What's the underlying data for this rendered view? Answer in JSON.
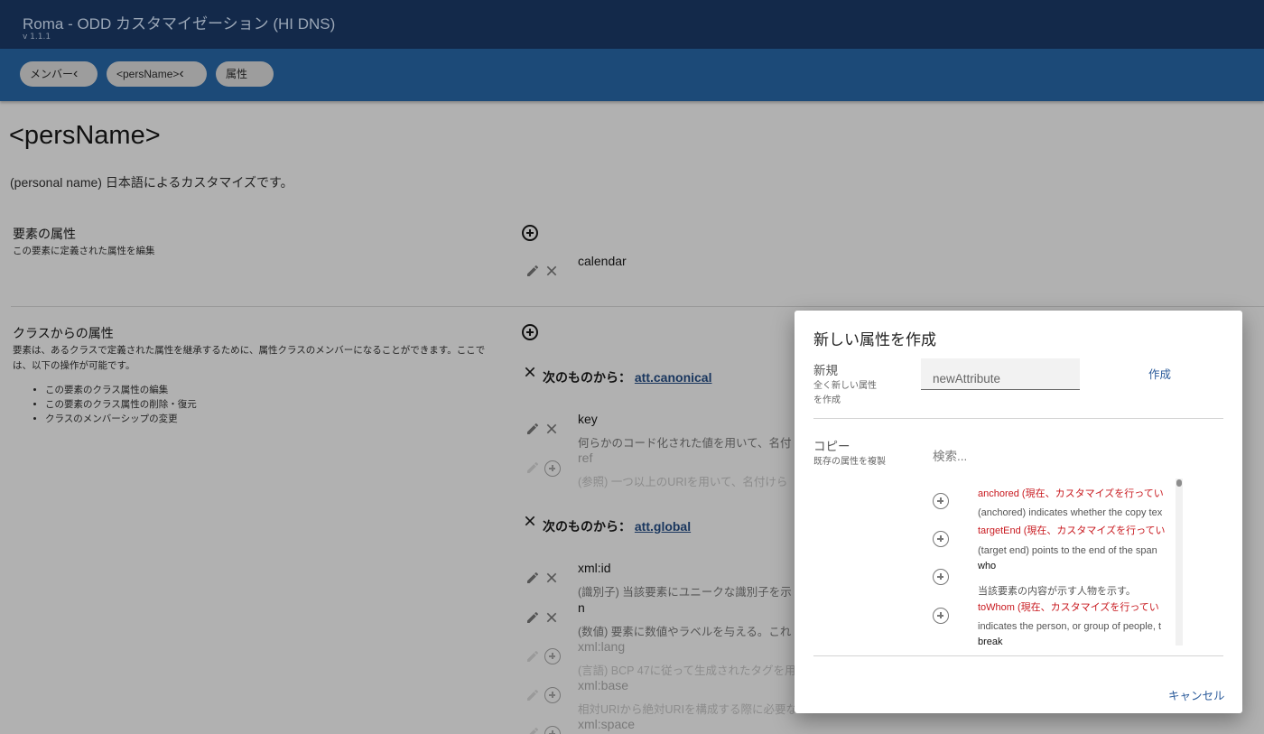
{
  "app": {
    "title": "Roma - ODD カスタマイゼーション (HI DNS)",
    "version": "v 1.1.1"
  },
  "breadcrumbs": [
    {
      "label": "メンバー",
      "chevron": "‹"
    },
    {
      "label": "<persName>",
      "chevron": "‹"
    },
    {
      "label": "属性"
    }
  ],
  "element": {
    "title": "<persName>",
    "description": "(personal name) 日本語によるカスタマイズです。"
  },
  "element_attributes": {
    "title": "要素の属性",
    "subtitle": "この要素に定義された属性を編集",
    "items": [
      {
        "name": "calendar"
      }
    ]
  },
  "class_attributes": {
    "title": "クラスからの属性",
    "subtitle": "要素は、あるクラスで定義された属性を継承するために、属性クラスのメンバーになることができます。ここでは、以下の操作が可能です。",
    "bullets": [
      "この要素のクラス属性の編集",
      "この要素のクラス属性の削除・復元",
      "クラスのメンバーシップの変更"
    ],
    "from_prefix": "次のものから：",
    "groups": [
      {
        "class": "att.canonical",
        "items": [
          {
            "name": "key",
            "desc": "何らかのコード化された値を用いて、名付"
          },
          {
            "name": "ref",
            "desc": "(参照) 一つ以上のURIを用いて、名付けら"
          }
        ]
      },
      {
        "class": "att.global",
        "items": [
          {
            "name": "xml:id",
            "desc": "(識別子) 当該要素にユニークな識別子を示"
          },
          {
            "name": "n",
            "desc": "(数値) 要素に数値やラベルを与える。これ"
          },
          {
            "name": "xml:lang",
            "desc": "(言語) BCP 47に従って生成されたタグを用"
          },
          {
            "name": "xml:base",
            "desc": "相対URIから絶対URIを構成する際に必要な"
          },
          {
            "name": "xml:space",
            "desc": ""
          }
        ]
      }
    ]
  },
  "dialog": {
    "title": "新しい属性を作成",
    "new_label": "新規",
    "new_sub": "全く新しい属性を作成",
    "input_placeholder": "newAttribute",
    "create_button": "作成",
    "copy_label": "コピー",
    "copy_sub": "既存の属性を複製",
    "search_placeholder": "検索...",
    "list": [
      {
        "name": "anchored (現在、カスタマイズを行ってい",
        "desc": "(anchored) indicates whether the copy tex",
        "customized": true
      },
      {
        "name": "targetEnd (現在、カスタマイズを行ってい",
        "desc": "(target end) points to the end of the span",
        "customized": true
      },
      {
        "name": "who",
        "desc": "当該要素の内容が示す人物を示す。",
        "customized": false
      },
      {
        "name": "toWhom (現在、カスタマイズを行ってい",
        "desc": "indicates the person, or group of people, t",
        "customized": true
      },
      {
        "name": "break",
        "desc": "",
        "customized": false
      }
    ],
    "cancel_button": "キャンセル"
  },
  "colors": {
    "topbar": "#13294a",
    "breadcrumb_bar": "#1c4a78",
    "accent_link": "#2a5a9a",
    "customized_red": "#c8181e"
  }
}
